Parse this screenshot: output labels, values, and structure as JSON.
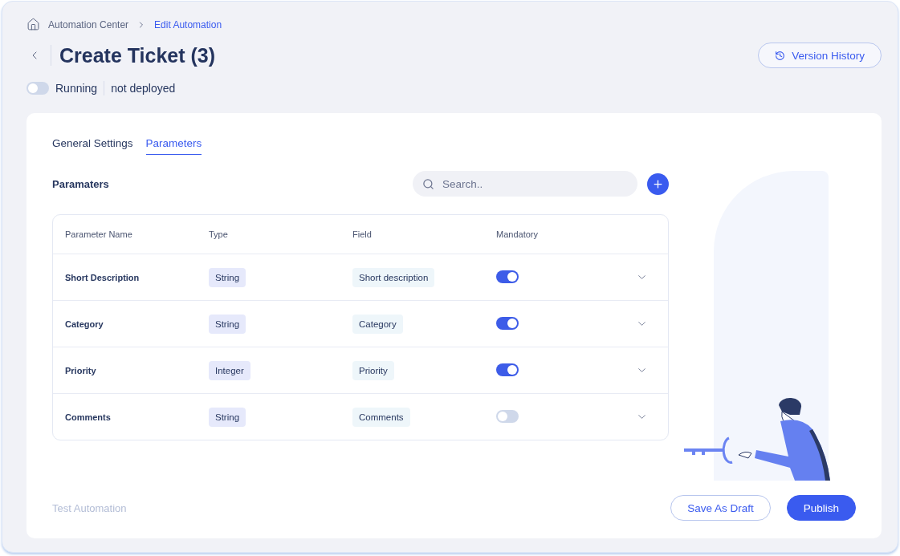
{
  "breadcrumb": [
    {
      "label": "Automation Center",
      "current": false
    },
    {
      "label": "Edit Automation",
      "current": true
    }
  ],
  "title": "Create Ticket (3)",
  "version_button": "Version History",
  "status": {
    "running": false,
    "label": "Running",
    "deployment": "not deployed"
  },
  "tabs": [
    {
      "label": "General Settings",
      "selected": false
    },
    {
      "label": "Parameters",
      "selected": true
    }
  ],
  "section_title": "Paramaters",
  "search": {
    "placeholder": "Search.."
  },
  "table": {
    "columns": [
      "Parameter Name",
      "Type",
      "Field",
      "Mandatory"
    ],
    "rows": [
      {
        "name": "Short Description",
        "type": "String",
        "field": "Short description",
        "mandatory": true
      },
      {
        "name": "Category",
        "type": "String",
        "field": "Category",
        "mandatory": true
      },
      {
        "name": "Priority",
        "type": "Integer",
        "field": "Priority",
        "mandatory": true
      },
      {
        "name": "Comments",
        "type": "String",
        "field": "Comments",
        "mandatory": false
      }
    ]
  },
  "footer": {
    "test_link": {
      "label": "Test Automation",
      "disabled": true
    },
    "buttons": [
      {
        "label": "Save As Draft",
        "kind": "outline"
      },
      {
        "label": "Publish",
        "kind": "primary"
      }
    ]
  }
}
